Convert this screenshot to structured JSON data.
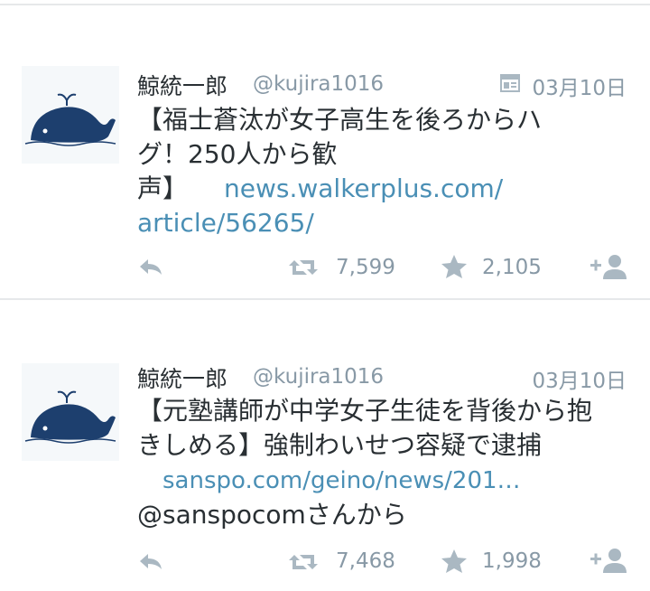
{
  "tweets": [
    {
      "user_name": "鯨統一郎",
      "handle": "@kujira1016",
      "date": "03月10日",
      "text_line1": "【福士蒼汰が女子高生を後ろからハ",
      "text_line2": "グ！250人から歓",
      "text_line3_prefix": "声】",
      "link_part1": "news.walkerplus.com/",
      "link_part2": "article/56265/",
      "retweets": "7,599",
      "favorites": "2,105"
    },
    {
      "user_name": "鯨統一郎",
      "handle": "@kujira1016",
      "date": "03月10日",
      "text_line1": "【元塾講師が中学女子生徒を背後から抱",
      "text_line2": "きしめる】強制わいせつ容疑で逮捕",
      "link": "sanspo.com/geino/news/201…",
      "mention_line": "@sanspocomさんから",
      "retweets": "7,468",
      "favorites": "1,998"
    }
  ],
  "icons": {
    "avatar": "whale-avatar-icon",
    "reply": "reply-icon",
    "retweet": "retweet-icon",
    "favorite": "star-icon",
    "follow": "follow-icon",
    "media": "media-card-icon"
  },
  "colors": {
    "link": "#4a8fb5",
    "meta": "#8899a6",
    "icon": "#aab8c2",
    "whale": "#1d3f6e"
  }
}
